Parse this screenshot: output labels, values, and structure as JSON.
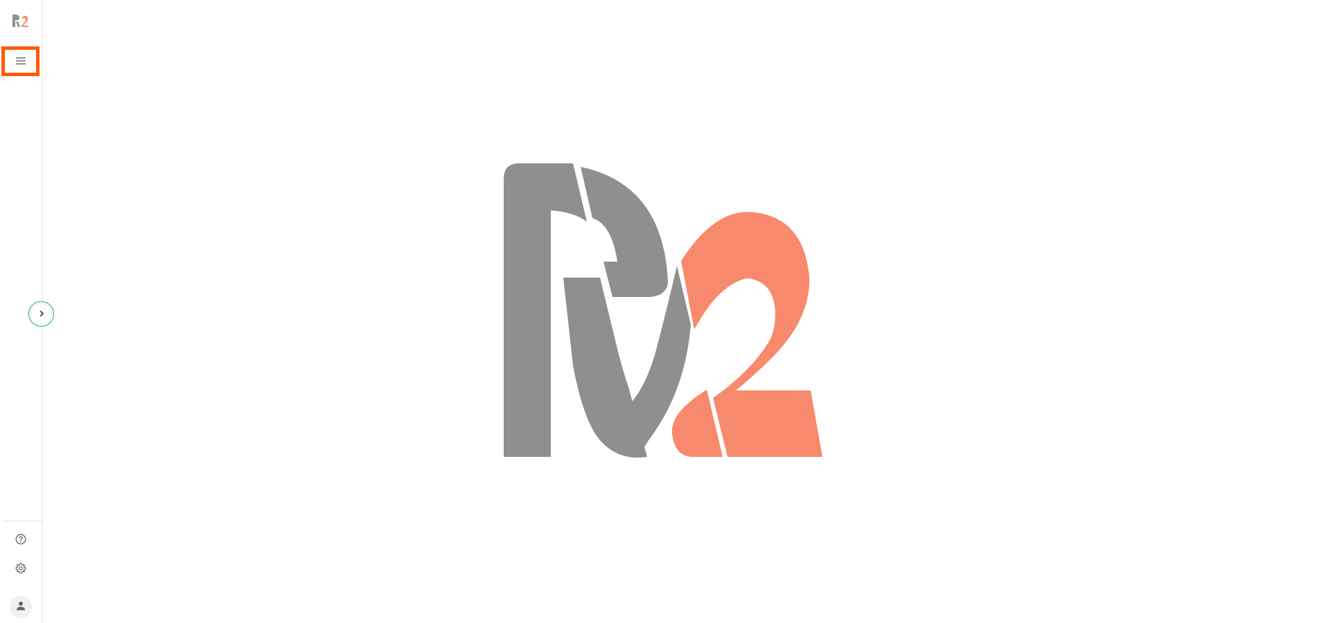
{
  "app": {
    "logo_icon": "r2-logo",
    "colors": {
      "logo_gray": "#8f8f8f",
      "logo_orange": "#f78a6c",
      "highlight": "#ff5a0a",
      "teal": "#1aa39a"
    }
  },
  "sidebar": {
    "menu_icon": "hamburger-menu-icon",
    "expand_icon": "chevron-right-icon",
    "help_icon": "help-circle-icon",
    "settings_icon": "gear-icon",
    "user_icon": "user-icon"
  },
  "main": {
    "splash_logo_icon": "r2-logo"
  }
}
